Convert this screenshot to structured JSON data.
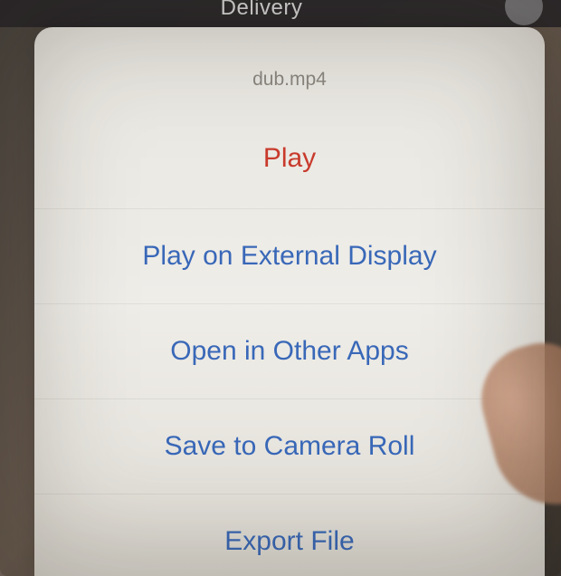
{
  "background": {
    "title_partial": "Delivery"
  },
  "sheet": {
    "filename": "dub.mp4",
    "actions": {
      "play": "Play",
      "external": "Play on External Display",
      "open_in": "Open in Other Apps",
      "save": "Save to Camera Roll",
      "export": "Export File"
    }
  }
}
